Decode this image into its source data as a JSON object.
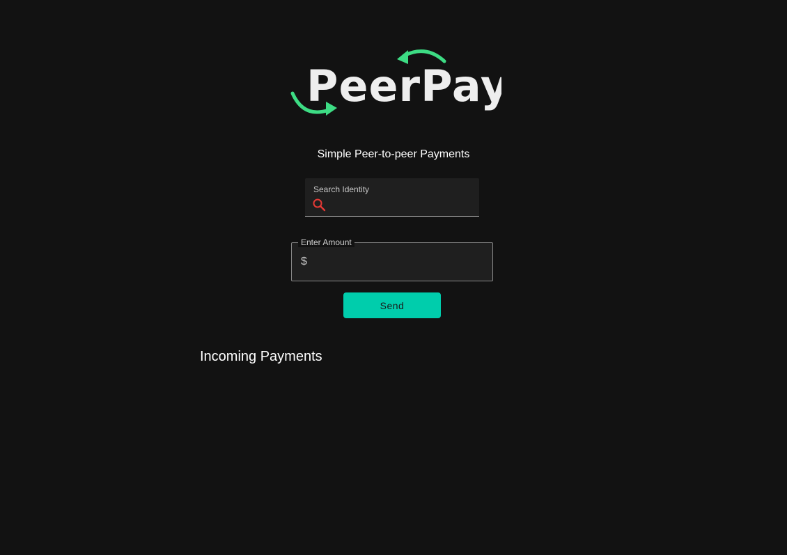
{
  "logo": {
    "text": "PeerPay",
    "accent_color": "#3ddc84",
    "icon": "circular-arrows-icon"
  },
  "tagline": "Simple Peer-to-peer Payments",
  "search": {
    "label": "Search Identity",
    "value": "",
    "icon": "search-icon",
    "icon_color": "#e53935"
  },
  "amount": {
    "label": "Enter Amount",
    "prefix": "$",
    "value": ""
  },
  "send": {
    "label": "Send",
    "color": "#00cdac"
  },
  "incoming": {
    "title": "Incoming Payments"
  }
}
